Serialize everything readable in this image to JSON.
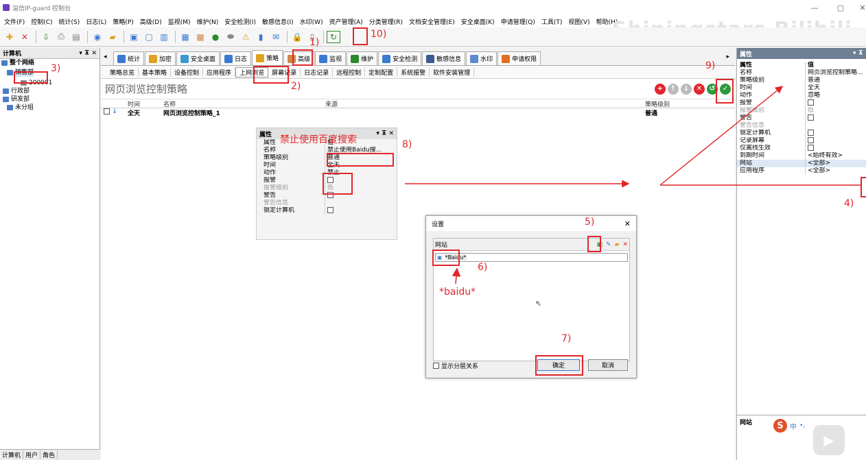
{
  "window": {
    "title": "溢信IP-guard 控制台",
    "controls": [
      "—",
      "▢",
      "✕"
    ]
  },
  "menu": [
    "文件(F)",
    "控制(C)",
    "统计(S)",
    "日志(L)",
    "策略(P)",
    "高级(D)",
    "监视(M)",
    "维护(N)",
    "安全检测(I)",
    "敏感信息(I)",
    "水印(W)",
    "资产管理(A)",
    "分类管理(R)",
    "文档安全管理(E)",
    "安全桌面(K)",
    "申请管理(Q)",
    "工具(T)",
    "视图(V)",
    "帮助(H)"
  ],
  "watermark": "Shiningstars Bilibili",
  "left_panel": {
    "title": "计算机",
    "tree": [
      {
        "label": "整个网络",
        "level": 0
      },
      {
        "label": "销售部",
        "level": 1
      },
      {
        "label": "200001",
        "level": 2
      },
      {
        "label": "行政部",
        "level": 1
      },
      {
        "label": "研发部",
        "level": 1
      },
      {
        "label": "未分组",
        "level": 1
      }
    ],
    "bottom_tabs": [
      "计算机",
      "用户",
      "角色"
    ]
  },
  "tabs": [
    "统计",
    "加密",
    "安全桌面",
    "日志",
    "策略",
    "高级",
    "监视",
    "维护",
    "安全检测",
    "敏感信息",
    "水印",
    "申请权限"
  ],
  "subtabs": [
    "策略总览",
    "基本策略",
    "设备控制",
    "应用程序",
    "上网浏览",
    "屏幕记录",
    "日志记录",
    "远程控制",
    "定制配置",
    "系统报警",
    "软件安装管理"
  ],
  "policy": {
    "title": "网页浏览控制策略",
    "columns": [
      "时间",
      "名称",
      "来源",
      "策略级别"
    ],
    "rows": [
      {
        "time": "全天",
        "name": "网页浏览控制策略_1",
        "source": "",
        "level": "普通"
      }
    ]
  },
  "overlay_props": {
    "title": "属性",
    "rows": [
      {
        "k": "属性",
        "v": "值"
      },
      {
        "k": "名称",
        "v": "禁止使用Baidu搜..."
      },
      {
        "k": "策略级别",
        "v": "普通"
      },
      {
        "k": "时间",
        "v": "全天"
      },
      {
        "k": "动作",
        "v": "禁止"
      },
      {
        "k": "报警",
        "v": ""
      },
      {
        "k": "报警级别",
        "v": "低"
      },
      {
        "k": "警告",
        "v": ""
      },
      {
        "k": "警告信息",
        "v": ""
      },
      {
        "k": "锁定计算机",
        "v": ""
      }
    ]
  },
  "dialog": {
    "title": "设置",
    "section": "网站",
    "item": "*Baidu*",
    "show_hierarchy": "显示分层关系",
    "ok": "确定",
    "cancel": "取消"
  },
  "right_panel": {
    "title": "属性",
    "rows": [
      {
        "k": "属性",
        "v": "值"
      },
      {
        "k": "名称",
        "v": "网页浏览控制策略..."
      },
      {
        "k": "策略级别",
        "v": "普通"
      },
      {
        "k": "时间",
        "v": "全天"
      },
      {
        "k": "动作",
        "v": "忽略"
      },
      {
        "k": "报警",
        "v": ""
      },
      {
        "k": "报警级别",
        "v": "低"
      },
      {
        "k": "警告",
        "v": ""
      },
      {
        "k": "警告信息",
        "v": ""
      },
      {
        "k": "锁定计算机",
        "v": ""
      },
      {
        "k": "记录屏幕",
        "v": ""
      },
      {
        "k": "仅离线生效",
        "v": ""
      },
      {
        "k": "到期时间",
        "v": "<始终有效>"
      },
      {
        "k": "网站",
        "v": "<全部>"
      },
      {
        "k": "应用程序",
        "v": "<全部>"
      }
    ],
    "bottom_title": "网站"
  },
  "annotations": {
    "a1": "1)",
    "a2": "2)",
    "a3": "3)",
    "a4": "4)",
    "a5": "5)",
    "a6": "6)",
    "a7": "7)",
    "a8": "8)",
    "a9": "9)",
    "a10": "10)",
    "note_name": "禁止使用百度搜索",
    "note_baidu": "*baidu*"
  },
  "ime": {
    "label": "中"
  },
  "colors": {
    "accent": "#e0262a",
    "header": "#6d7f93"
  }
}
